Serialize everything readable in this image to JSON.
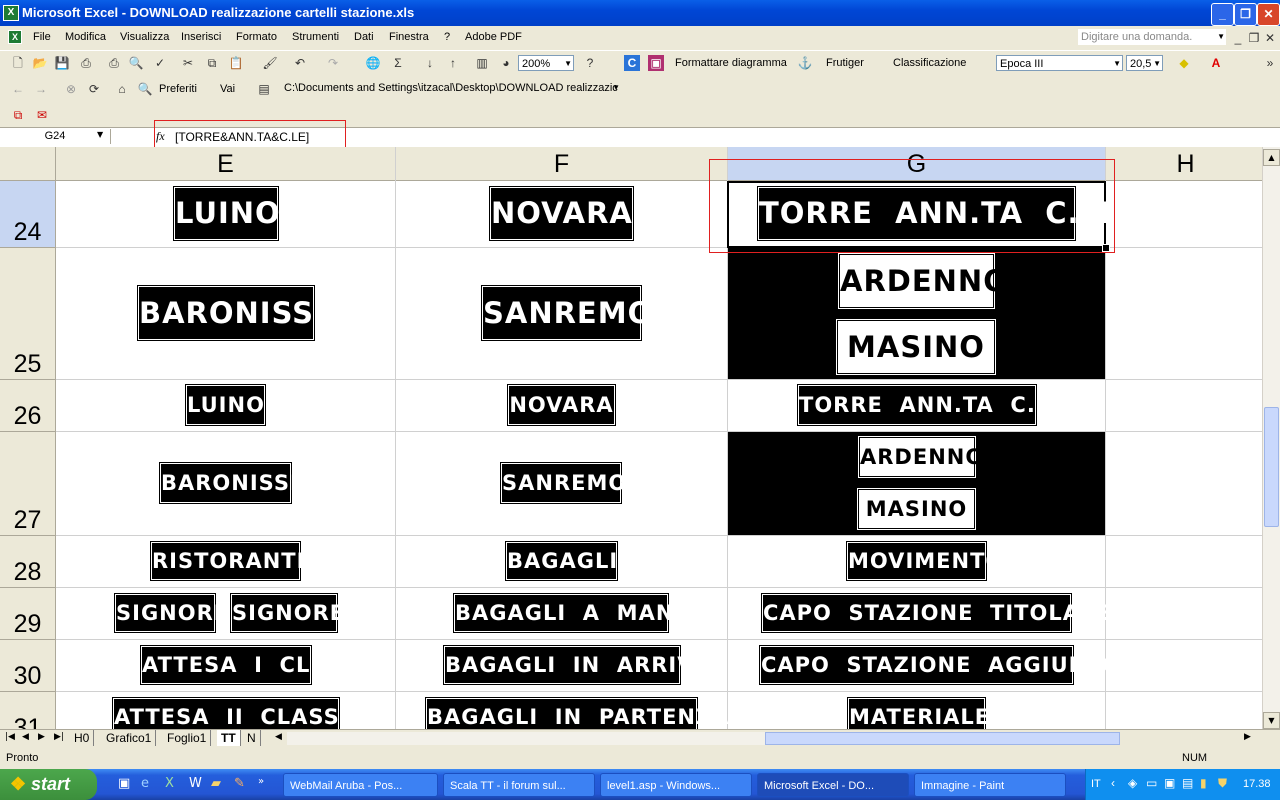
{
  "window": {
    "title": "Microsoft Excel - DOWNLOAD realizzazione cartelli stazione.xls"
  },
  "menu": [
    "File",
    "Modifica",
    "Visualizza",
    "Inserisci",
    "Formato",
    "Strumenti",
    "Dati",
    "Finestra",
    "?",
    "Adobe PDF"
  ],
  "help_box": {
    "placeholder": "Digitare una domanda."
  },
  "toolbar": {
    "zoom": "200%",
    "format_chart": "Formattare diagramma",
    "font_label": "Frutiger",
    "classification": "Classificazione",
    "font_combo": "Epoca III",
    "font_size": "20,5",
    "favorites": "Preferiti",
    "go": "Vai",
    "address": "C:\\Documents and Settings\\itzacal\\Desktop\\DOWNLOAD realizzazic"
  },
  "formula_bar": {
    "cell_ref": "G24",
    "fx": "fx",
    "formula": "[TORRE&ANN.TA&C.LE]"
  },
  "columns": [
    "E",
    "F",
    "G",
    "H"
  ],
  "rows": [
    "24",
    "25",
    "26",
    "27",
    "28",
    "29",
    "30",
    "31"
  ],
  "cells": {
    "r24": {
      "E": "LUINO",
      "F": "NOVARA",
      "G": "TORRE  ANN.TA  C.LE"
    },
    "r25": {
      "E": "BARONISSI",
      "F": "SANREMO",
      "G1": "ARDENNO",
      "G2": "MASINO"
    },
    "r26": {
      "E": "LUINO",
      "F": "NOVARA",
      "G": "TORRE  ANN.TA  C.LE"
    },
    "r27": {
      "E": "BARONISSI",
      "F": "SANREMO",
      "G1": "ARDENNO",
      "G2": "MASINO"
    },
    "r28": {
      "E": "RISTORANTE",
      "F": "BAGAGLI",
      "G": "MOVIMENTO"
    },
    "r29": {
      "E1": "SIGNORI",
      "E2": "SIGNORE",
      "F": "BAGAGLI  A  MANO",
      "G": "CAPO  STAZIONE  TITOLARE"
    },
    "r30": {
      "E": "ATTESA  I  CL.",
      "F": "BAGAGLI  IN  ARRIVO",
      "G": "CAPO  STAZIONE  AGGIUNTO"
    },
    "r31": {
      "E": "ATTESA  II  CLASSE",
      "F": "BAGAGLI  IN  PARTENZA",
      "G": "MATERIALE"
    }
  },
  "sheet_tabs": [
    "H0",
    "Grafico1",
    "Foglio1",
    "TT",
    "N"
  ],
  "active_tab": "TT",
  "status": {
    "left": "Pronto",
    "right": "NUM"
  },
  "taskbar": {
    "start": "start",
    "items": [
      "WebMail Aruba - Pos...",
      "Scala TT - il forum sul...",
      "level1.asp - Windows...",
      "Microsoft Excel - DO...",
      "Immagine - Paint"
    ],
    "lang": "IT",
    "clock": "17.38"
  },
  "colors": {
    "selection_header": "#C7D6F2",
    "highlight_box": "#E02020",
    "sign_bg": "#000000",
    "taskbar": "#245EDC"
  }
}
